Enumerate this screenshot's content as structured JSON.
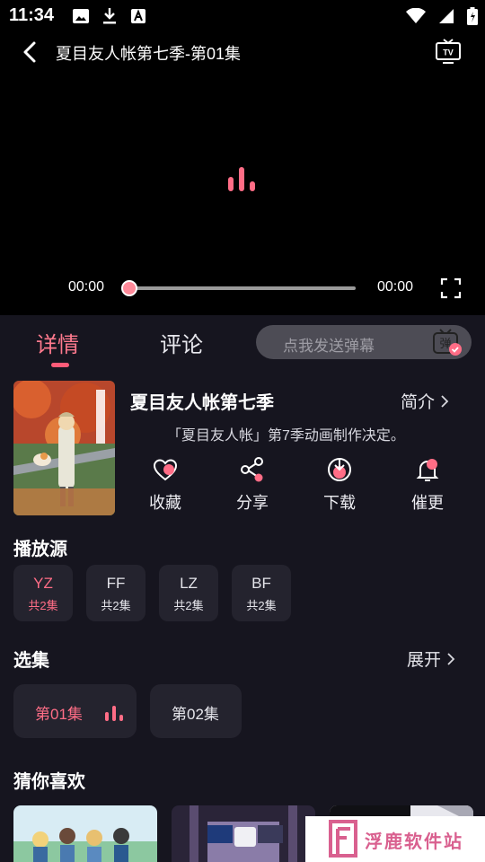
{
  "status_bar": {
    "time": "11:34",
    "left_icons": [
      "image-icon",
      "download-icon",
      "a-box-icon"
    ],
    "right_icons": [
      "wifi-icon",
      "signal-icon",
      "battery-icon"
    ]
  },
  "player": {
    "title": "夏目友人帐第七季-第01集",
    "current_time": "00:00",
    "duration": "00:00",
    "progress": 0
  },
  "tabs": [
    {
      "label": "详情",
      "active": true
    },
    {
      "label": "评论",
      "active": false
    }
  ],
  "danmaku": {
    "placeholder": "点我发送弹幕",
    "icon_char": "弹"
  },
  "anime": {
    "title": "夏目友人帐第七季",
    "intro_label": "简介",
    "description": "「夏目友人帐」第7季动画制作决定。"
  },
  "actions": [
    {
      "label": "收藏",
      "icon": "heart-icon"
    },
    {
      "label": "分享",
      "icon": "share-icon"
    },
    {
      "label": "下载",
      "icon": "download-icon"
    },
    {
      "label": "催更",
      "icon": "bell-icon"
    }
  ],
  "sources": {
    "title": "播放源",
    "items": [
      {
        "name": "YZ",
        "count": "共2集",
        "active": true
      },
      {
        "name": "FF",
        "count": "共2集",
        "active": false
      },
      {
        "name": "LZ",
        "count": "共2集",
        "active": false
      },
      {
        "name": "BF",
        "count": "共2集",
        "active": false
      }
    ]
  },
  "episodes": {
    "title": "选集",
    "expand_label": "展开",
    "items": [
      {
        "label": "第01集",
        "active": true
      },
      {
        "label": "第02集",
        "active": false
      }
    ]
  },
  "recommend": {
    "title": "猜你喜欢"
  },
  "watermark": {
    "text": "浮鹿软件站"
  },
  "colors": {
    "accent": "#ff6d86",
    "background": "#16151f",
    "card": "#24232e"
  }
}
